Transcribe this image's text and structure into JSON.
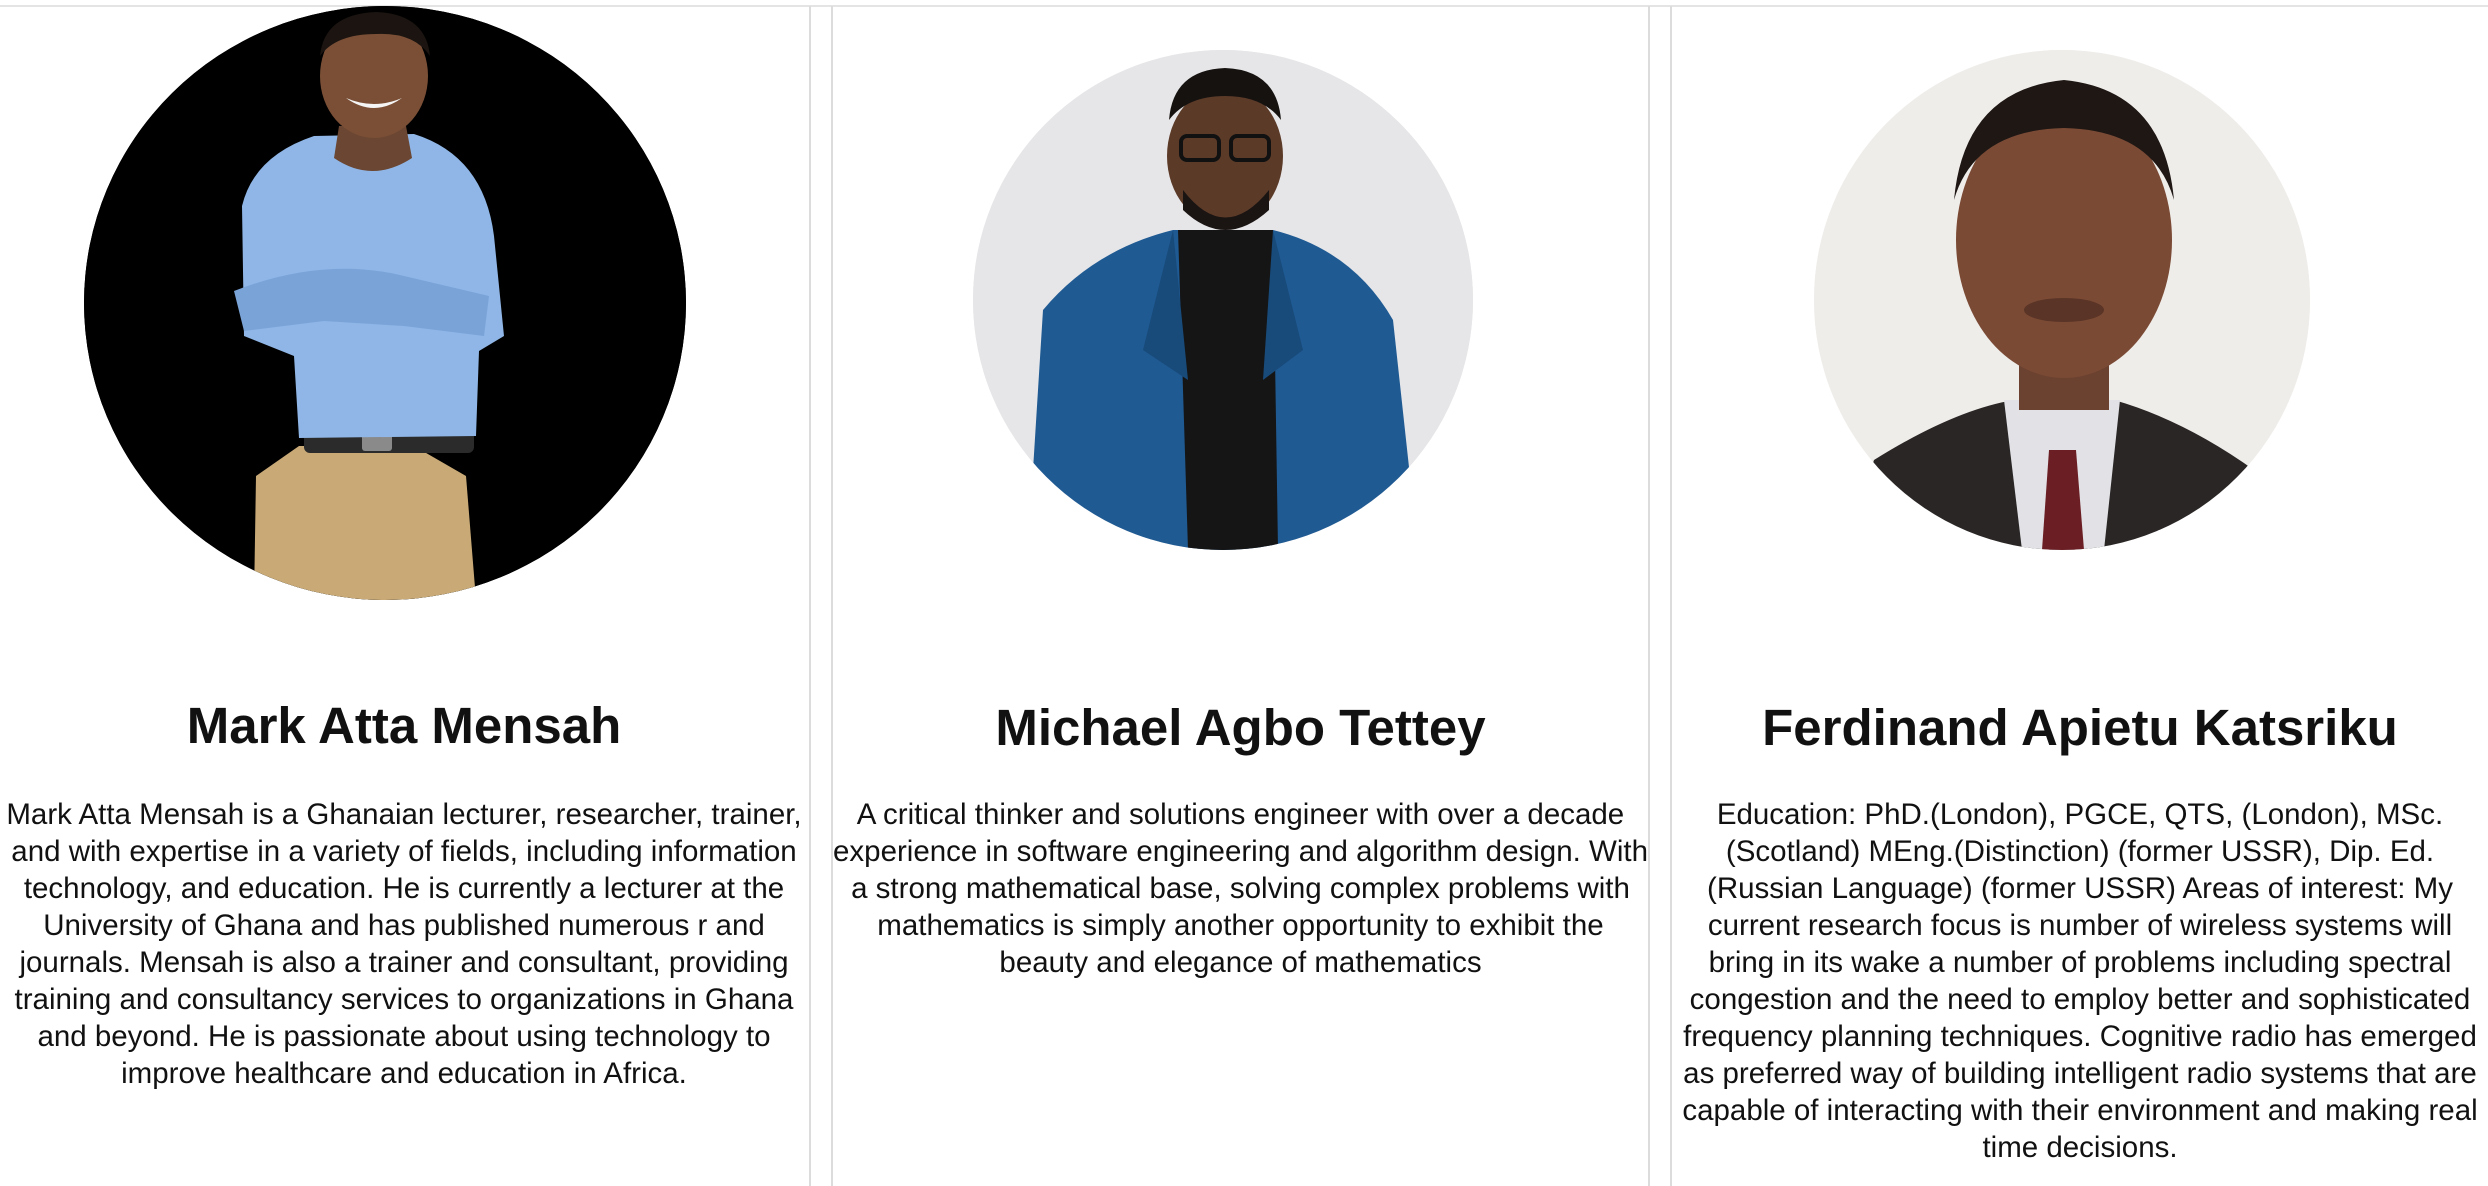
{
  "team": [
    {
      "name": "Mark Atta Mensah",
      "bio": "Mark Atta Mensah is a Ghanaian lecturer, researcher, trainer, and with expertise in a variety of fields, including information technology, and education. He is currently a lecturer at the University of Ghana and has published numerous r and journals. Mensah is also a trainer and consultant, providing training and consultancy services to organizations in Ghana and beyond. He is passionate about using technology to improve healthcare and education in Africa.",
      "photo_background": "#000000"
    },
    {
      "name": "Michael Agbo Tettey",
      "bio": "A critical thinker and solutions engineer with over a decade experience in software engineering and algorithm design. With a strong mathematical base, solving complex problems with mathematics is simply another opportunity to exhibit the beauty and elegance of mathematics",
      "photo_background": "#e6e6e8"
    },
    {
      "name": "Ferdinand Apietu Katsriku",
      "bio": "Education: PhD.(London), PGCE, QTS, (London), MSc. (Scotland) MEng.(Distinction) (former USSR), Dip. Ed. (Russian Language) (former USSR) Areas of interest: My current research focus is number of wireless systems will bring in its wake a number of problems including spectral congestion and the need to employ better and sophisticated frequency planning techniques. Cognitive radio has emerged as preferred way of building intelligent radio systems that are capable of interacting with their environment and making real time decisions.",
      "photo_background": "#efedea"
    }
  ]
}
